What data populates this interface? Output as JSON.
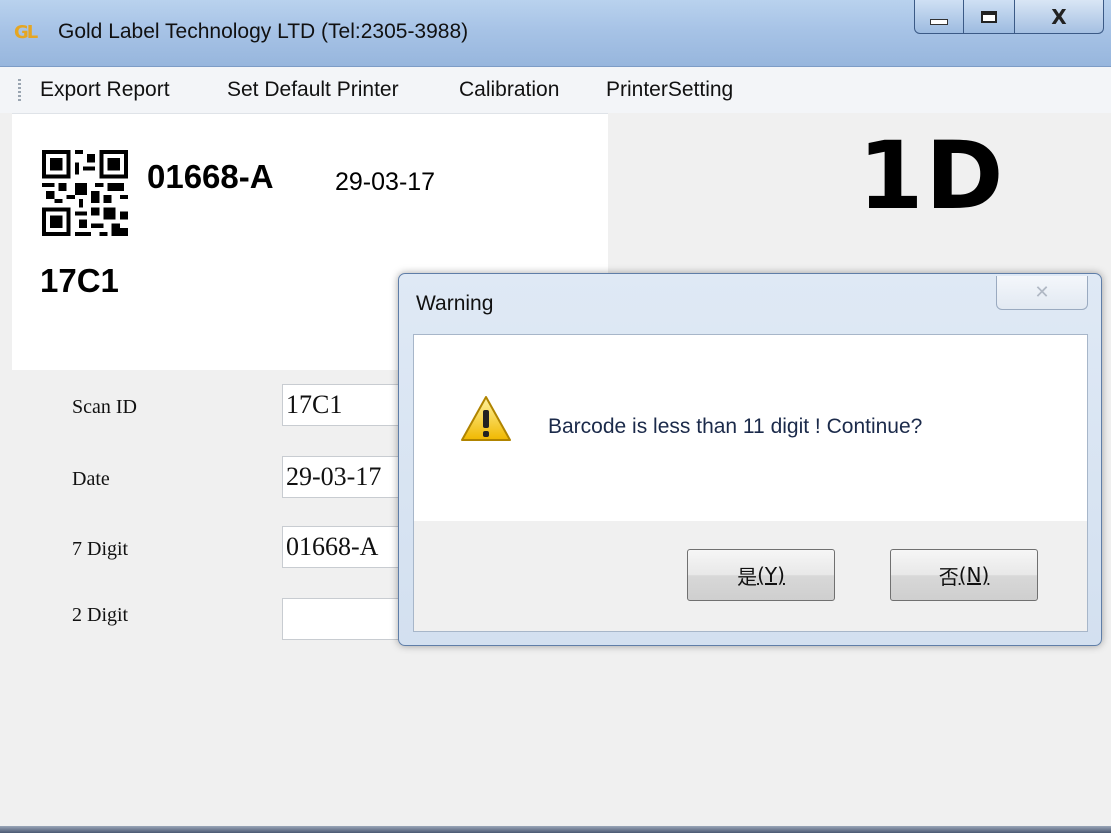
{
  "window": {
    "title": "Gold Label Technology LTD (Tel:2305-3988)",
    "icon_text": "GL",
    "controls": {
      "close": "X"
    }
  },
  "menu": {
    "items": [
      "Export Report",
      "Set Default Printer",
      "Calibration",
      "PrinterSetting"
    ]
  },
  "label_preview": {
    "code": "01668-A",
    "date": "29-03-17",
    "scan_id": "17C1",
    "type_badge": "1D"
  },
  "form": {
    "fields": [
      {
        "label": "Scan ID",
        "value": "17C1"
      },
      {
        "label": "Date",
        "value": "29-03-17"
      },
      {
        "label": "7 Digit",
        "value": "01668-A"
      },
      {
        "label": "2 Digit",
        "value": ""
      }
    ]
  },
  "dialog": {
    "title": "Warning",
    "close_symbol": "✕",
    "message": "Barcode is less than 11 digit ! Continue?",
    "yes_label": "是",
    "yes_mnemonic": "(Y)",
    "no_label": "否",
    "no_mnemonic": "(N)",
    "icon": "warning-triangle-icon"
  },
  "colors": {
    "titlebar": "#a7c3e6",
    "dialog_frame": "#d3e0f0",
    "warning_yellow": "#f3c400",
    "form_background": "#f0f0f0"
  }
}
